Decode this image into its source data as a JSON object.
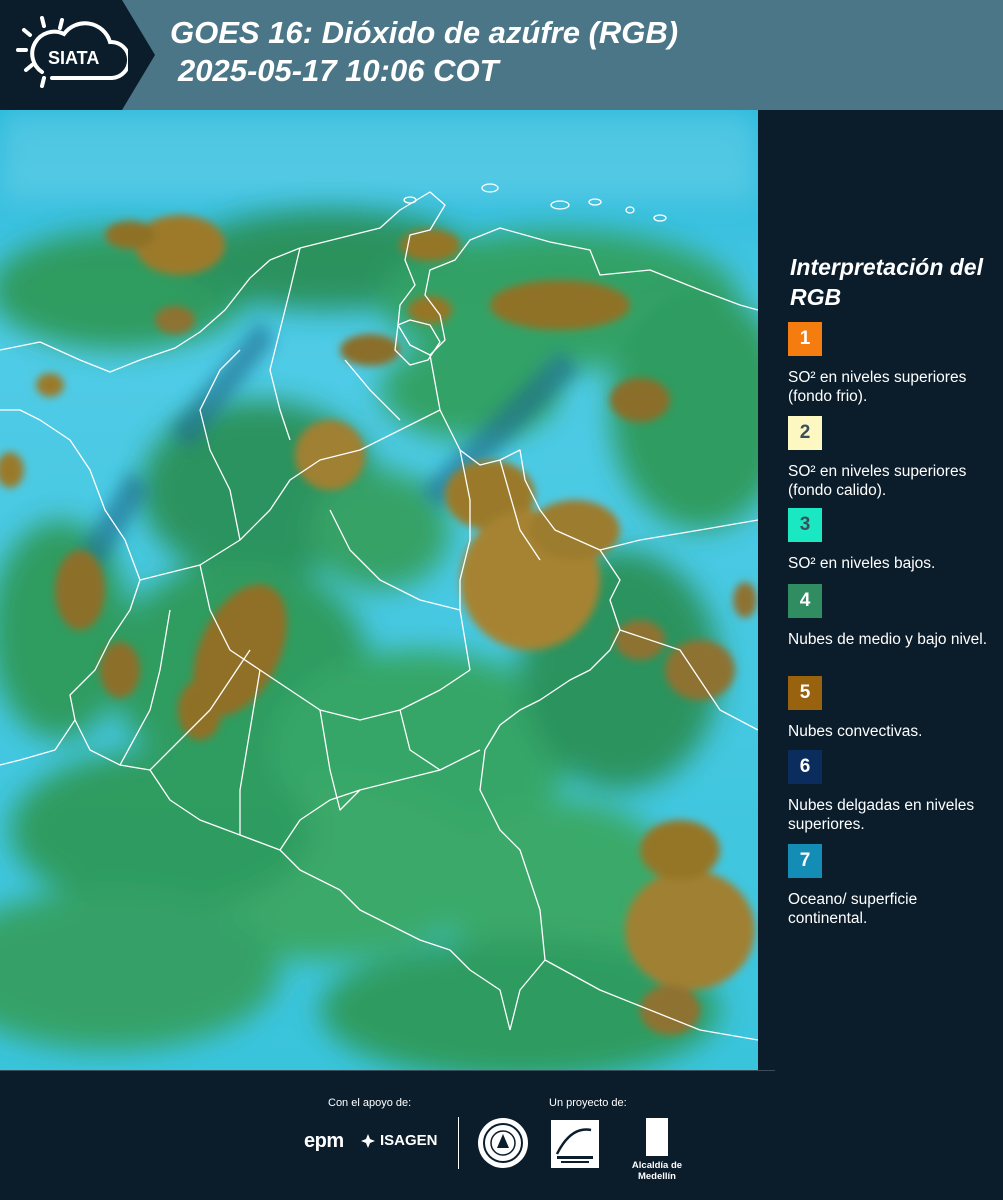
{
  "header": {
    "logo_text": "SIATA",
    "title_line1": "GOES 16: Dióxido de azúfre (RGB)",
    "title_line2": "2025-05-17 10:06 COT"
  },
  "legend": {
    "title": "Interpretación del RGB",
    "items": [
      {
        "number": "1",
        "color": "#f57c0f",
        "text_dark": false,
        "description": "SO² en niveles superiores (fondo frio)."
      },
      {
        "number": "2",
        "color": "#fdf7c2",
        "text_dark": true,
        "description": "SO² en niveles superiores (fondo calido)."
      },
      {
        "number": "3",
        "color": "#19e8c3",
        "text_dark": true,
        "description": "SO² en niveles bajos."
      },
      {
        "number": "4",
        "color": "#2f8d61",
        "text_dark": false,
        "description": "Nubes de medio y bajo nivel."
      },
      {
        "number": "5",
        "color": "#99620e",
        "text_dark": false,
        "description": "Nubes convectivas."
      },
      {
        "number": "6",
        "color": "#0b2d5e",
        "text_dark": false,
        "description": "Nubes delgadas en niveles superiores."
      },
      {
        "number": "7",
        "color": "#138db5",
        "text_dark": false,
        "description": "Oceano/ superficie continental."
      }
    ]
  },
  "footer": {
    "support_label": "Con el apoyo de:",
    "project_label": "Un proyecto de:",
    "sponsor_1": "epm",
    "sponsor_2": "ISAGEN",
    "partner_1": "Área Metropolitana Valle de Aburrá",
    "partner_2": "Alcaldía de Medellín"
  },
  "map": {
    "colors": {
      "sky": "#33c2e0",
      "low_clouds": "#2f9a5a",
      "convective": "#9a7b2a",
      "boundaries": "#ffffff"
    }
  }
}
